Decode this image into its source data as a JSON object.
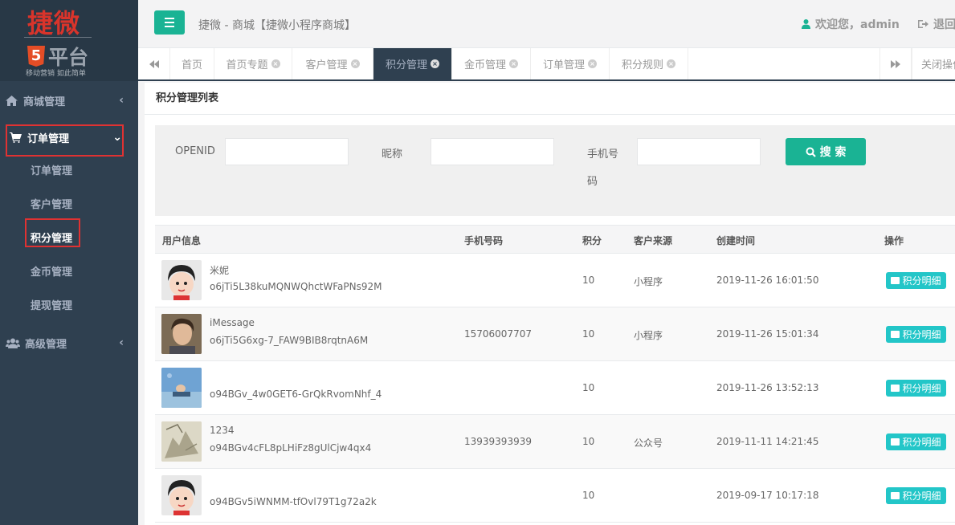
{
  "logo": {
    "brand": "捷微",
    "h5": "5",
    "platform": "平台",
    "slogan": "移动营销 如此简单"
  },
  "sidebar": {
    "groups": [
      {
        "label": "商城管理"
      },
      {
        "label": "订单管理"
      },
      {
        "label": "高级管理"
      }
    ],
    "sub_items": [
      {
        "label": "订单管理"
      },
      {
        "label": "客户管理"
      },
      {
        "label": "积分管理"
      },
      {
        "label": "金币管理"
      },
      {
        "label": "提现管理"
      }
    ]
  },
  "header": {
    "breadcrumb": "捷微 - 商城【捷微小程序商城】",
    "welcome": "欢迎您，admin",
    "logout": "退回"
  },
  "tabs": [
    {
      "label": "首页"
    },
    {
      "label": "首页专题"
    },
    {
      "label": "客户管理"
    },
    {
      "label": "积分管理"
    },
    {
      "label": "金币管理"
    },
    {
      "label": "订单管理"
    },
    {
      "label": "积分规则"
    }
  ],
  "close_ops": "关闭操作",
  "panel": {
    "title": "积分管理列表"
  },
  "filter": {
    "openid_label": "OPENID",
    "nickname_label": "昵称",
    "phone_label_1": "手机号",
    "phone_label_2": "码",
    "search_label": "搜 索"
  },
  "table": {
    "headers": {
      "user": "用户信息",
      "phone": "手机号码",
      "points": "积分",
      "source": "客户来源",
      "created": "创建时间",
      "ops": "操作"
    },
    "action_label": "积分明细",
    "rows": [
      {
        "nick": "米妮",
        "openid": "o6jTi5L38kuMQNWQhctWFaPNs92M",
        "phone": "",
        "points": "10",
        "source": "小程序",
        "created": "2019-11-26 16:01:50",
        "avatar": "cartoon"
      },
      {
        "nick": "iMessage",
        "openid": "o6jTi5G6xg-7_FAW9BIB8rqtnA6M",
        "phone": "15706007707",
        "points": "10",
        "source": "小程序",
        "created": "2019-11-26 15:01:34",
        "avatar": "photo"
      },
      {
        "nick": "",
        "openid": "o94BGv_4w0GET6-GrQkRvomNhf_4",
        "phone": "",
        "points": "10",
        "source": "",
        "created": "2019-11-26 13:52:13",
        "avatar": "water"
      },
      {
        "nick": "1234",
        "openid": "o94BGv4cFL8pLHiFz8gUlCjw4qx4",
        "phone": "13939393939",
        "points": "10",
        "source": "公众号",
        "created": "2019-11-11 14:21:45",
        "avatar": "sketch"
      },
      {
        "nick": "",
        "openid": "o94BGv5iWNMM-tfOvl79T1g72a2k",
        "phone": "",
        "points": "10",
        "source": "",
        "created": "2019-09-17 10:17:18",
        "avatar": "cartoon"
      }
    ]
  }
}
